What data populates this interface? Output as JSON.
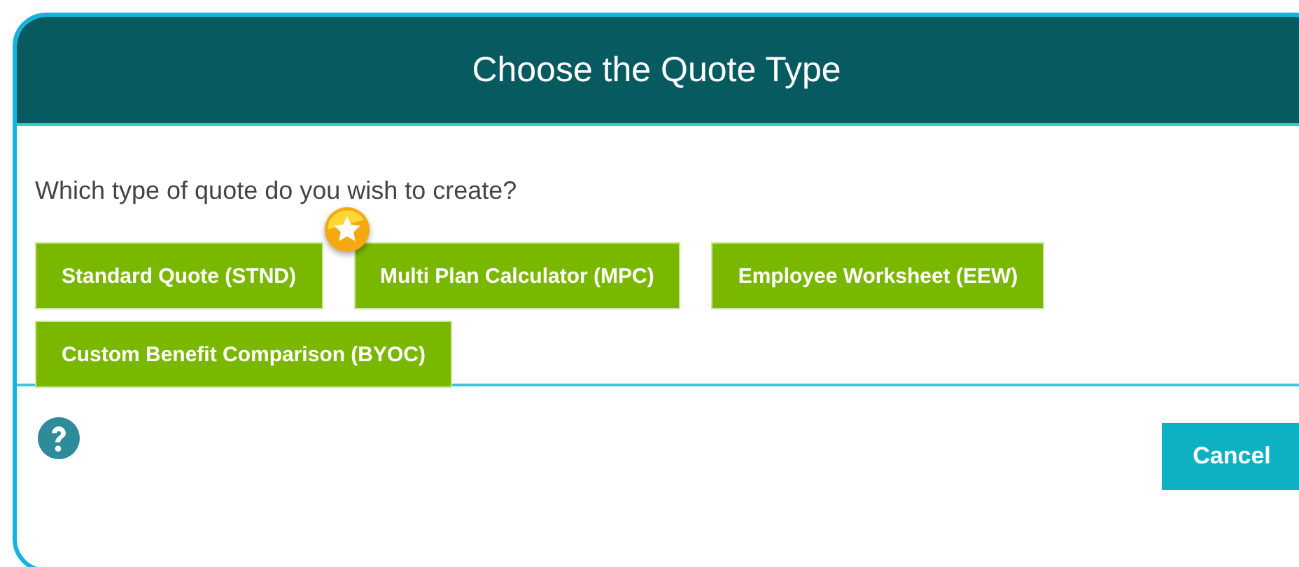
{
  "dialog": {
    "title": "Choose the Quote Type",
    "question": "Which type of quote do you wish to create?",
    "options": [
      {
        "label": "Standard Quote (STND)",
        "starred": false
      },
      {
        "label": "Multi Plan Calculator (MPC)",
        "starred": true
      },
      {
        "label": "Employee Worksheet (EEW)",
        "starred": false
      },
      {
        "label": "Custom Benefit Comparison (BYOC)",
        "starred": false
      }
    ],
    "footer": {
      "help": true,
      "cancel": "Cancel"
    }
  }
}
